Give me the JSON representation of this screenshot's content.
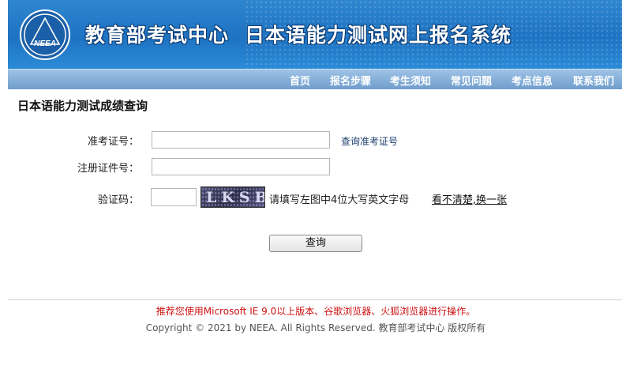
{
  "header": {
    "logo_text": "NEEA",
    "org_name": "教育部考试中心",
    "system_name": "日本语能力测试网上报名系统"
  },
  "nav": {
    "items": [
      "首页",
      "报名步骤",
      "考生须知",
      "常见问题",
      "考点信息",
      "联系我们"
    ]
  },
  "page": {
    "heading": "日本语能力测试成绩查询"
  },
  "form": {
    "exam_number_label": "准考证号：",
    "exam_number_value": "",
    "lookup_link": "查询准考证号",
    "id_number_label": "注册证件号：",
    "id_number_value": "",
    "captcha_label": "验证码：",
    "captcha_value": "",
    "captcha_image_text": "LKSB",
    "captcha_hint": "请填写左图中4位大写英文字母",
    "captcha_refresh": "看不清楚,换一张",
    "submit_label": "查询"
  },
  "footer": {
    "notice": "推荐您使用Microsoft IE 9.0以上版本、谷歌浏览器、火狐浏览器进行操作。",
    "copyright": "Copyright © 2021 by NEEA. All Rights Reserved. 教育部考试中心 版权所有"
  },
  "colors": {
    "banner_blue": "#1e73c2",
    "nav_blue": "#7fa9d6",
    "notice_red": "#cc1111"
  }
}
